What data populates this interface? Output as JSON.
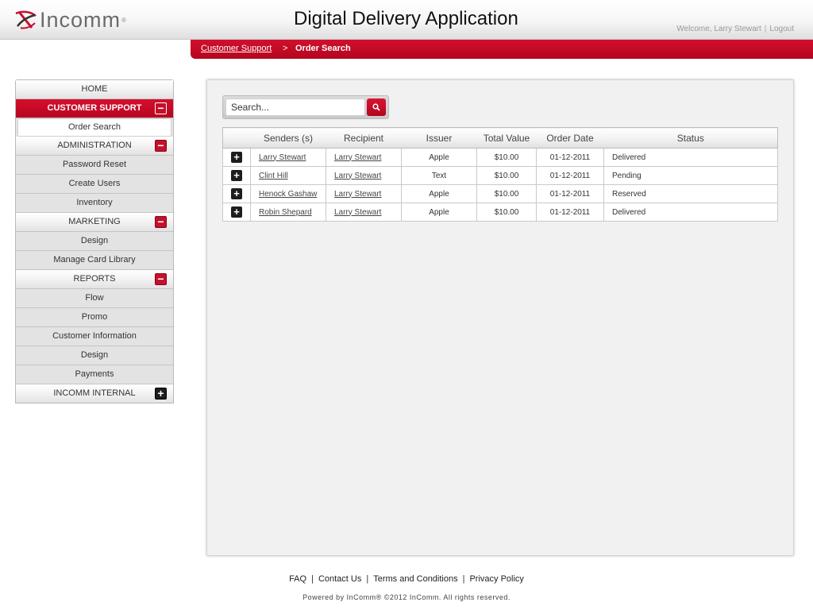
{
  "header": {
    "logo_text": "Incomm",
    "logo_tm": "®",
    "app_title": "Digital Delivery Application",
    "welcome": "Welcome, Larry Stewart",
    "separator": "|",
    "logout": "Logout"
  },
  "breadcrumb": {
    "parent": "Customer Support",
    "separator": ">",
    "current": "Order Search"
  },
  "sidebar": {
    "home": "HOME",
    "customer_support": {
      "label": "CUSTOMER SUPPORT",
      "toggle": "−",
      "items": [
        "Order Search"
      ]
    },
    "administration": {
      "label": "ADMINISTRATION",
      "toggle": "−",
      "items": [
        "Password Reset",
        "Create Users",
        "Inventory"
      ]
    },
    "marketing": {
      "label": "MARKETING",
      "toggle": "−",
      "items": [
        "Design",
        "Manage Card Library"
      ]
    },
    "reports": {
      "label": "REPORTS",
      "toggle": "−",
      "items": [
        "Flow",
        "Promo",
        "Customer Information",
        "Design",
        "Payments"
      ]
    },
    "incomm_internal": {
      "label": "INCOMM INTERNAL",
      "toggle": "+"
    }
  },
  "search": {
    "placeholder": "Search..."
  },
  "table": {
    "columns": [
      "Senders (s)",
      "Recipient",
      "Issuer",
      "Total Value",
      "Order Date",
      "Status"
    ],
    "expander": "+",
    "rows": [
      {
        "sender": "Larry Stewart",
        "recipient": "Larry Stewart",
        "issuer": "Apple",
        "value": "$10.00",
        "date": "01-12-2011",
        "status": "Delivered"
      },
      {
        "sender": "Clint Hill",
        "recipient": "Larry Stewart",
        "issuer": "Text",
        "value": "$10.00",
        "date": "01-12-2011",
        "status": "Pending"
      },
      {
        "sender": "Henock Gashaw",
        "recipient": "Larry Stewart",
        "issuer": "Apple",
        "value": "$10.00",
        "date": "01-12-2011",
        "status": "Reserved"
      },
      {
        "sender": "Robin Shepard",
        "recipient": "Larry Stewart",
        "issuer": "Apple",
        "value": "$10.00",
        "date": "01-12-2011",
        "status": "Delivered"
      }
    ]
  },
  "footer": {
    "links": [
      "FAQ",
      "Contact Us",
      "Terms and Conditions",
      "Privacy Policy"
    ],
    "separator": "|",
    "copyright": "Powered by InComm® ©2012 InComm. All rights reserved."
  },
  "colors": {
    "brand_red": "#c4112d",
    "dark_button": "#1d1d1d"
  },
  "icons": {
    "search": "search-icon",
    "expand": "plus-icon",
    "collapse": "minus-icon"
  }
}
